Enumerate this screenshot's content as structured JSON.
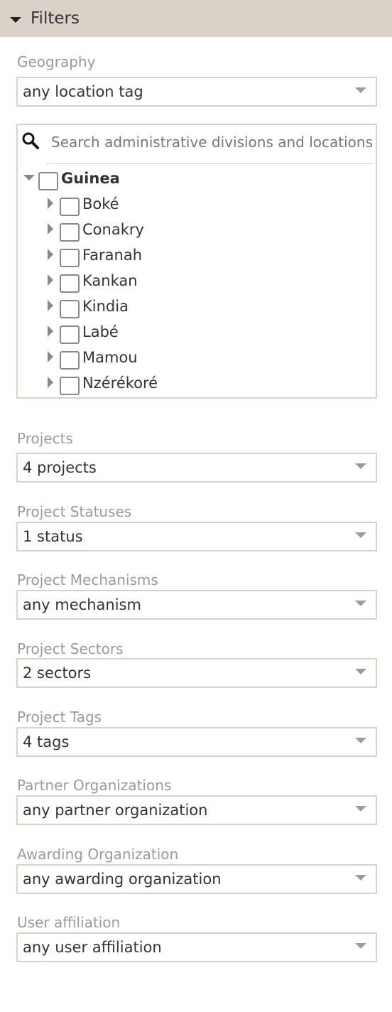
{
  "header": {
    "title": "Filters"
  },
  "geography": {
    "label": "Geography",
    "value": "any location tag",
    "tree": {
      "search_placeholder": "Search administrative divisions and locations",
      "root": "Guinea",
      "children": [
        "Boké",
        "Conakry",
        "Faranah",
        "Kankan",
        "Kindia",
        "Labé",
        "Mamou",
        "Nzérékoré"
      ]
    }
  },
  "filters": [
    {
      "label": "Projects",
      "value": "4 projects"
    },
    {
      "label": "Project Statuses",
      "value": "1 status"
    },
    {
      "label": "Project Mechanisms",
      "value": "any mechanism"
    },
    {
      "label": "Project Sectors",
      "value": "2 sectors"
    },
    {
      "label": "Project Tags",
      "value": "4 tags"
    },
    {
      "label": "Partner Organizations",
      "value": "any partner organization"
    },
    {
      "label": "Awarding Organization",
      "value": "any awarding organization"
    },
    {
      "label": "User affiliation",
      "value": "any user affiliation"
    }
  ]
}
